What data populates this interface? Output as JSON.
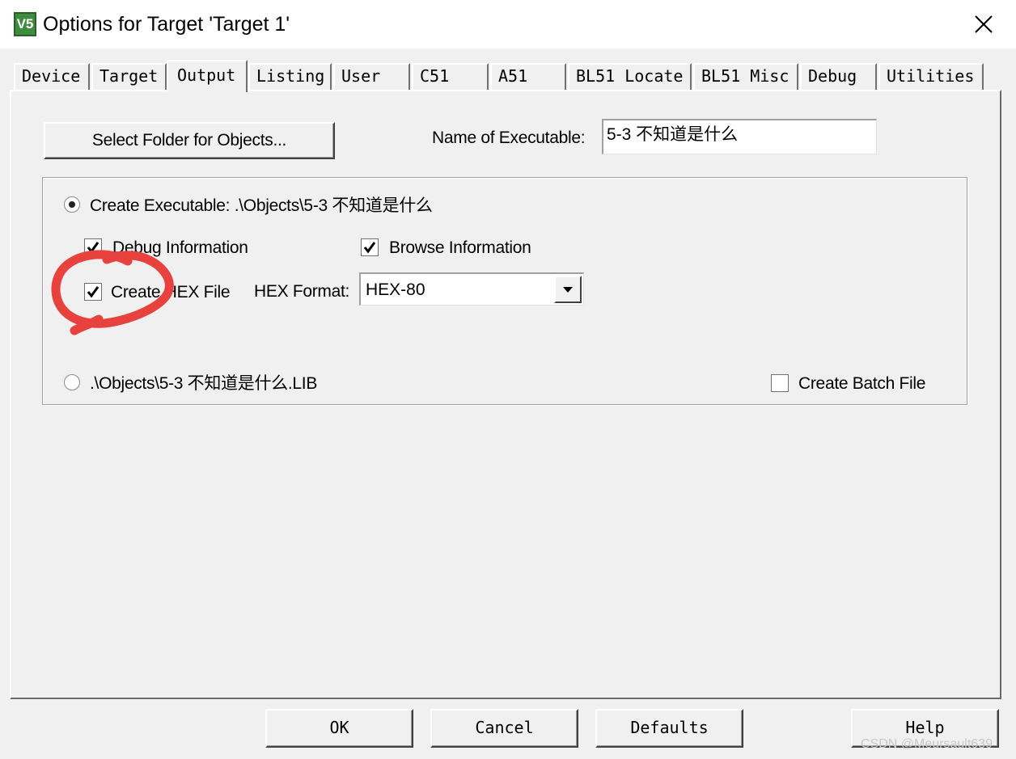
{
  "window": {
    "title": "Options for Target 'Target 1'",
    "app_icon_text": "V5",
    "close_icon": "close-icon"
  },
  "tabs": [
    {
      "label": "Device",
      "active": false
    },
    {
      "label": "Target",
      "active": false
    },
    {
      "label": "Output",
      "active": true
    },
    {
      "label": "Listing",
      "active": false
    },
    {
      "label": "User",
      "active": false
    },
    {
      "label": "C51",
      "active": false
    },
    {
      "label": "A51",
      "active": false
    },
    {
      "label": "BL51 Locate",
      "active": false
    },
    {
      "label": "BL51 Misc",
      "active": false
    },
    {
      "label": "Debug",
      "active": false
    },
    {
      "label": "Utilities",
      "active": false
    }
  ],
  "output": {
    "select_folder_button": "Select Folder for Objects...",
    "name_of_executable_label": "Name of Executable:",
    "name_of_executable_value": "5-3 不知道是什么",
    "create_executable_label": "Create Executable:  .\\Objects\\5-3 不知道是什么",
    "create_executable_selected": true,
    "debug_information_label": "Debug Information",
    "debug_information_checked": true,
    "browse_information_label": "Browse Information",
    "browse_information_checked": true,
    "create_hex_label": "Create HEX File",
    "create_hex_checked": true,
    "hex_format_label": "HEX Format:",
    "hex_format_value": "HEX-80",
    "create_library_label": ".\\Objects\\5-3 不知道是什么.LIB",
    "create_library_selected": false,
    "create_batch_label": "Create Batch File",
    "create_batch_checked": false
  },
  "buttons": {
    "ok": "OK",
    "cancel": "Cancel",
    "defaults": "Defaults",
    "help": "Help"
  },
  "annotation_color": "#e8423e",
  "watermark": "CSDN @Meursault639"
}
